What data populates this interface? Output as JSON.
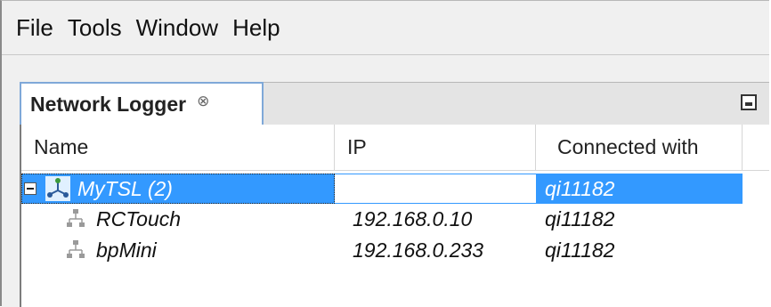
{
  "menu": [
    "File",
    "Tools",
    "Window",
    "Help"
  ],
  "tab": {
    "title": "Network Logger",
    "close_glyph": "⊗"
  },
  "columns": {
    "name": "Name",
    "ip": "IP",
    "connected": "Connected with"
  },
  "rows": [
    {
      "name": "MyTSL (2)",
      "ip": "",
      "connected": "qi11182",
      "icon": "network-group-icon",
      "selected": true
    },
    {
      "name": "RCTouch",
      "ip": "192.168.0.10",
      "connected": "qi11182",
      "icon": "network-node-icon"
    },
    {
      "name": "bpMini",
      "ip": "192.168.0.233",
      "connected": "qi11182",
      "icon": "network-node-icon"
    }
  ],
  "colors": {
    "selection": "#3399ff",
    "tab_border": "#7fa8d8"
  }
}
